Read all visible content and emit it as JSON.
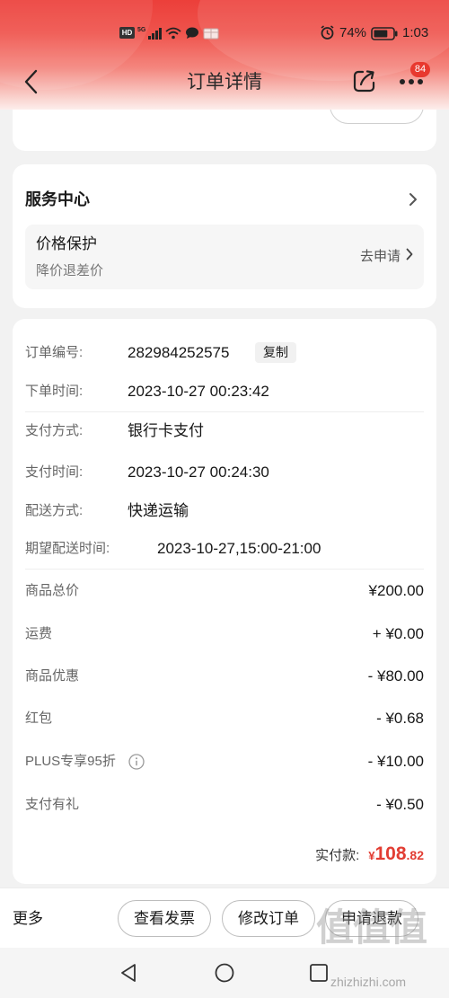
{
  "status_bar": {
    "hd_label": "HD",
    "network_type": "5G",
    "battery_percent": "74%",
    "battery_level": 0.74,
    "time": "1:03"
  },
  "nav": {
    "title": "订单详情",
    "more_badge": "84"
  },
  "service_center": {
    "title": "服务中心",
    "price_protection": {
      "title": "价格保护",
      "subtitle": "降价退差价",
      "action_label": "去申请"
    }
  },
  "order_info": {
    "copy_label": "复制",
    "rows": [
      {
        "label": "订单编号:",
        "value": "282984252575"
      },
      {
        "label": "下单时间:",
        "value": "2023-10-27 00:23:42"
      },
      {
        "label": "支付方式:",
        "value": "银行卡支付"
      },
      {
        "label": "支付时间:",
        "value": "2023-10-27 00:24:30"
      },
      {
        "label": "配送方式:",
        "value": "快递运输"
      },
      {
        "label": "期望配送时间:",
        "value": "2023-10-27,15:00-21:00"
      }
    ]
  },
  "price_details": {
    "rows": [
      {
        "label": "商品总价",
        "amount": "¥200.00"
      },
      {
        "label": "运费",
        "amount": "+ ¥0.00"
      },
      {
        "label": "商品优惠",
        "amount": "- ¥80.00"
      },
      {
        "label": "红包",
        "amount": "- ¥0.68"
      },
      {
        "label": "PLUS专享95折",
        "amount": "- ¥10.00"
      },
      {
        "label": "支付有礼",
        "amount": "- ¥0.50"
      }
    ],
    "total": {
      "label": "实付款:",
      "currency": "¥",
      "integer": "108",
      "decimal": ".82"
    }
  },
  "bottom_bar": {
    "more_label": "更多",
    "buttons": [
      {
        "label": "查看发票"
      },
      {
        "label": "修改订单"
      },
      {
        "label": "申请退款"
      }
    ]
  },
  "watermark": {
    "logo_text": "值值值",
    "site": "zhizhizhi.com"
  },
  "icons": [
    "signal-icon",
    "wifi-icon",
    "chat-icon",
    "package-icon",
    "alarm-icon",
    "battery-icon",
    "back-arrow-icon",
    "share-icon",
    "more-icon",
    "chevron-right-icon",
    "info-icon",
    "nav-back-icon",
    "nav-home-icon",
    "nav-recents-icon"
  ],
  "colors": {
    "header_red": "#ec3f3a",
    "accent_red": "#e23d33",
    "badge_red": "#e8392f",
    "page_background": "#f2f2f2",
    "card_background": "#ffffff",
    "label_gray": "#666666"
  }
}
